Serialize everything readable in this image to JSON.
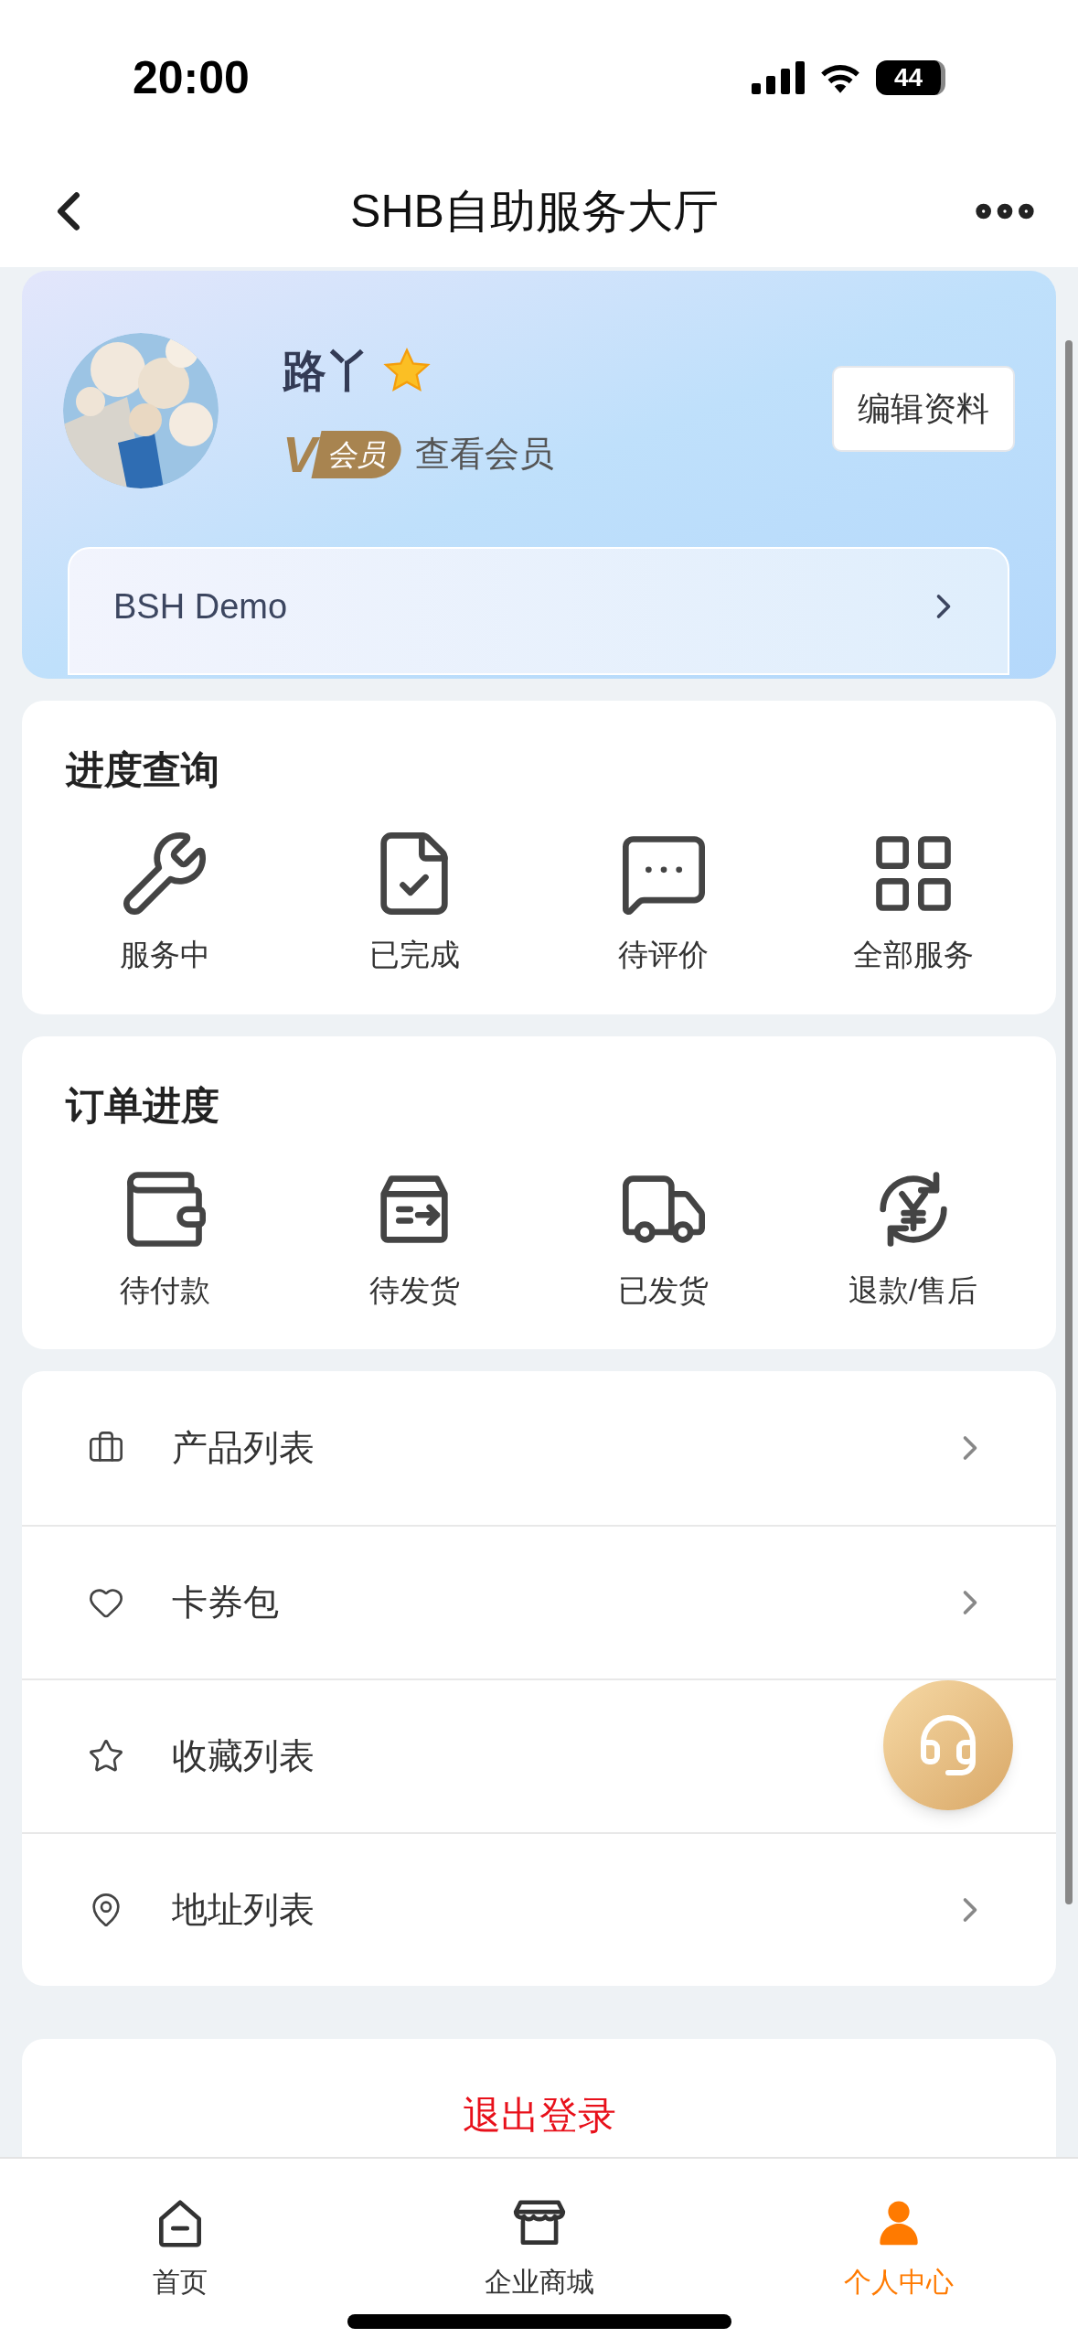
{
  "status_bar": {
    "time": "20:00",
    "battery": "44"
  },
  "nav_bar": {
    "title": "SHB自助服务大厅"
  },
  "profile": {
    "name": "路丫",
    "vip_badge": {
      "mark": "V",
      "label": "会员"
    },
    "vip_link": "查看会员",
    "edit_button": "编辑资料",
    "company": "BSH Demo"
  },
  "service_progress": {
    "title": "进度查询",
    "items": [
      {
        "kind": "tools",
        "label": "服务中"
      },
      {
        "kind": "done",
        "label": "已完成"
      },
      {
        "kind": "chat",
        "label": "待评价"
      },
      {
        "kind": "grid",
        "label": "全部服务"
      }
    ]
  },
  "order_progress": {
    "title": "订单进度",
    "items": [
      {
        "kind": "wallet",
        "label": "待付款"
      },
      {
        "kind": "box",
        "label": "待发货"
      },
      {
        "kind": "truck",
        "label": "已发货"
      },
      {
        "kind": "refund",
        "label": "退款/售后"
      }
    ]
  },
  "menu": [
    {
      "kind": "briefcase",
      "label": "产品列表"
    },
    {
      "kind": "heart",
      "label": "卡券包"
    },
    {
      "kind": "star",
      "label": "收藏列表"
    },
    {
      "kind": "pin",
      "label": "地址列表"
    }
  ],
  "logout_button": "退出登录",
  "tab_bar": [
    {
      "kind": "home",
      "label": "首页",
      "selected": false
    },
    {
      "kind": "store",
      "label": "企业商城",
      "selected": false
    },
    {
      "kind": "user",
      "label": "个人中心",
      "selected": true
    }
  ]
}
